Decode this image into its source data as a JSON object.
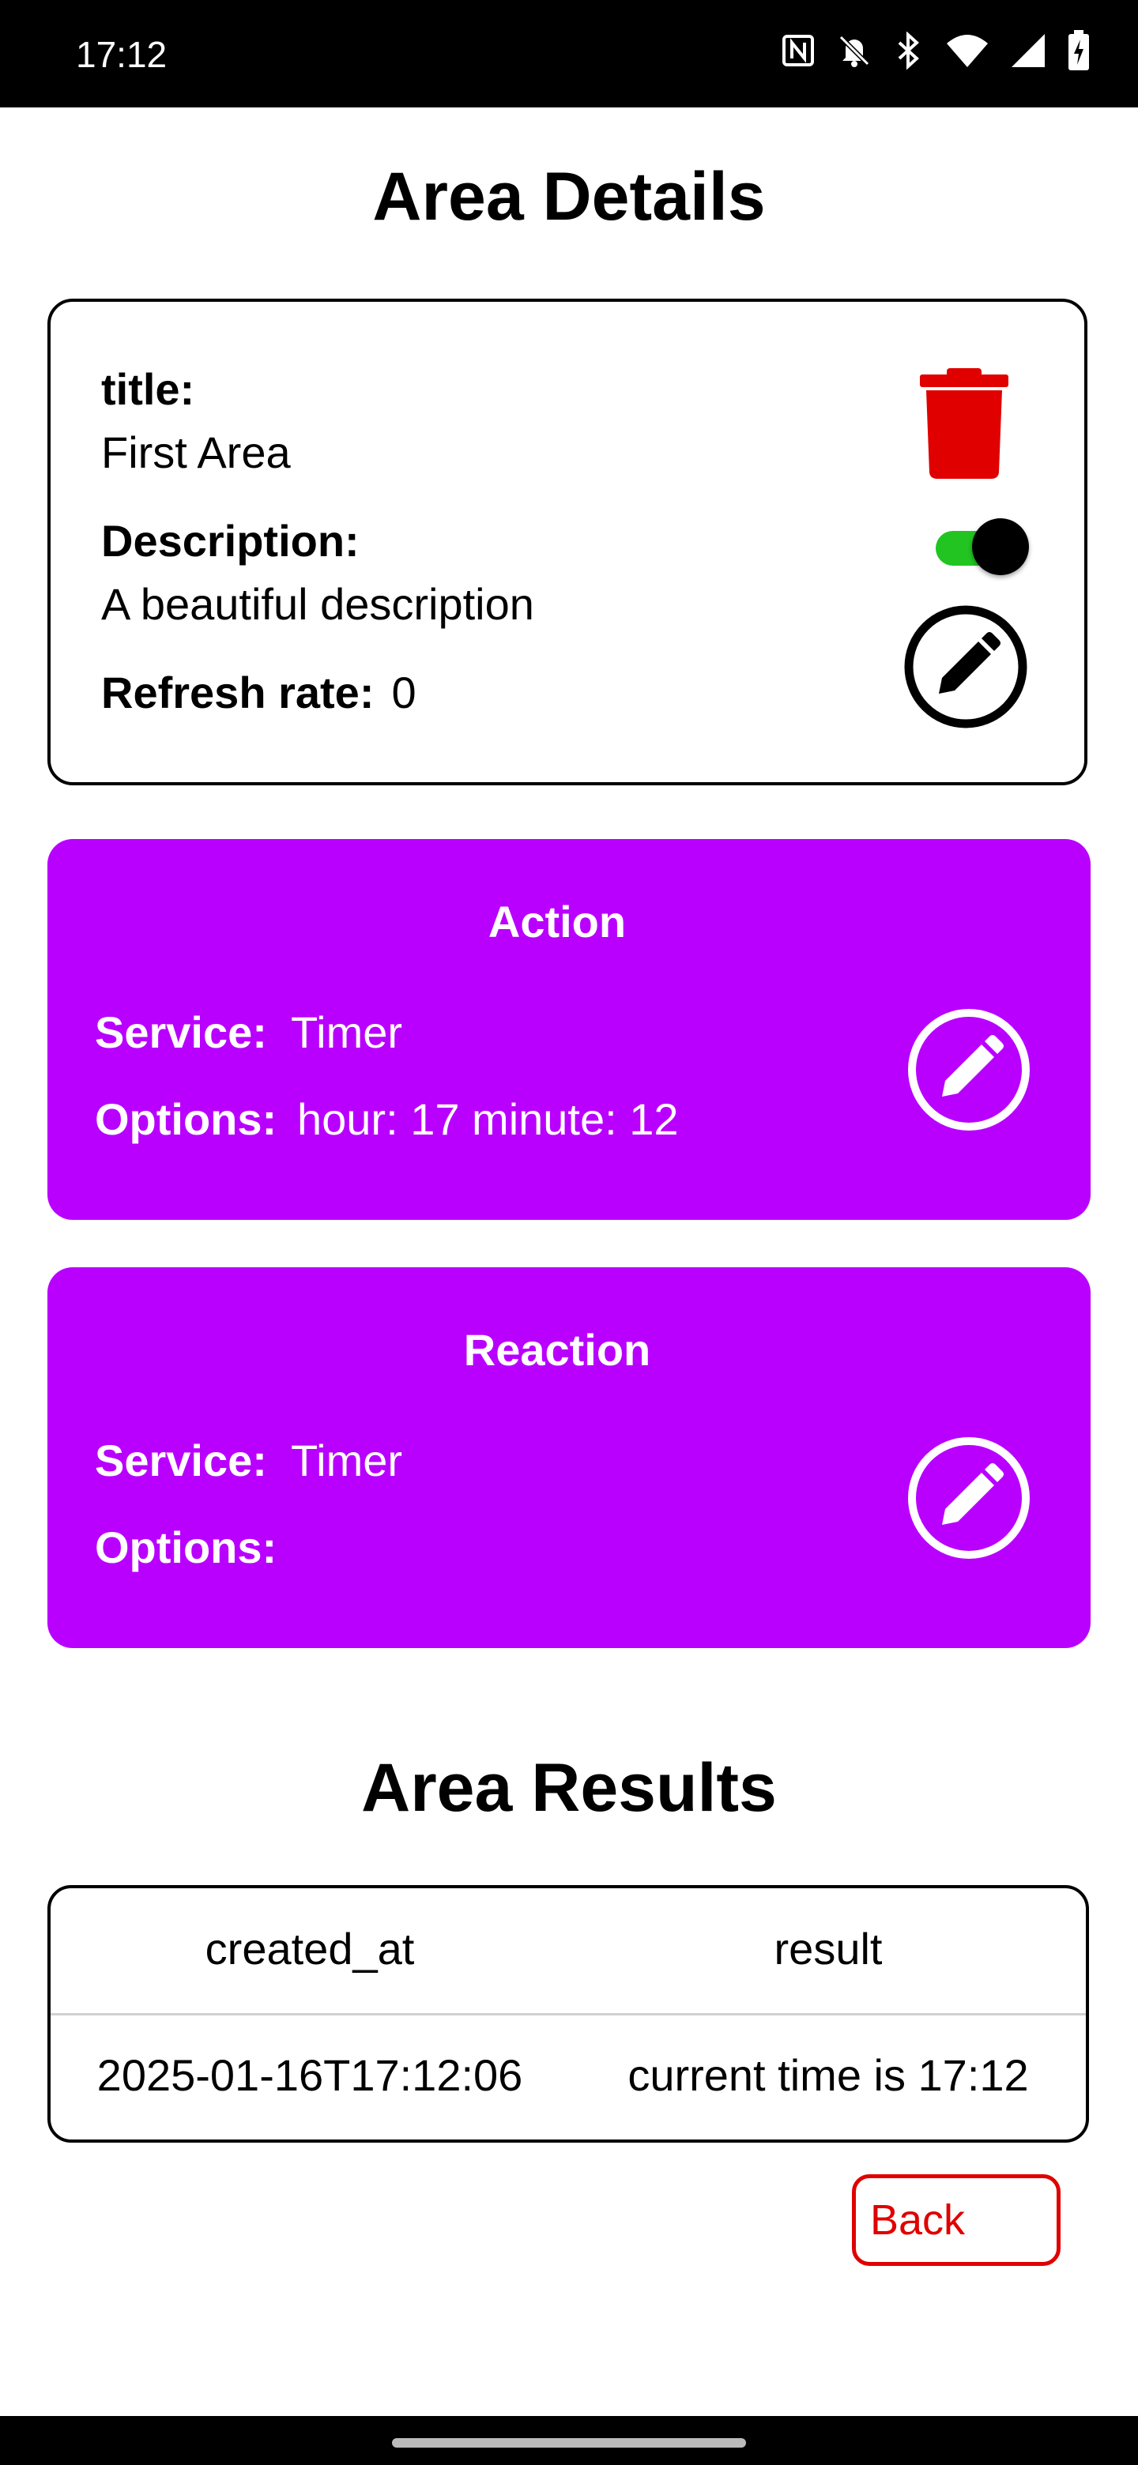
{
  "status_bar": {
    "time": "17:12"
  },
  "page": {
    "title": "Area Details"
  },
  "details": {
    "title_label": "title:",
    "title_value": "First Area",
    "description_label": "Description:",
    "description_value": "A beautiful description",
    "refresh_label": "Refresh rate:",
    "refresh_value": "0",
    "enabled": true
  },
  "action": {
    "heading": "Action",
    "service_label": "Service:",
    "service_value": "Timer",
    "options_label": "Options:",
    "options_value": "hour: 17 minute: 12"
  },
  "reaction": {
    "heading": "Reaction",
    "service_label": "Service:",
    "service_value": "Timer",
    "options_label": "Options:",
    "options_value": ""
  },
  "results": {
    "title": "Area Results",
    "columns": [
      "created_at",
      "result"
    ],
    "rows": [
      [
        "2025-01-16T17:12:06",
        "current time is 17:12"
      ]
    ]
  },
  "back_button": {
    "label": "Back"
  },
  "colors": {
    "accent_purple": "#b900ff",
    "delete_red": "#e00000",
    "toggle_green": "#21c421"
  }
}
